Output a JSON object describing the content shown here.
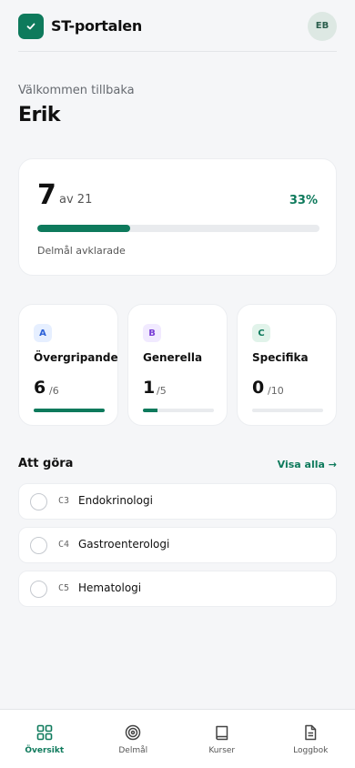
{
  "header": {
    "app_name": "ST-portalen",
    "avatar_initials": "EB"
  },
  "greeting": {
    "welcome": "Välkommen tillbaka",
    "name": "Erik"
  },
  "progress": {
    "done": "7",
    "of_label": "av 21",
    "percent_label": "33%",
    "fraction": 0.33,
    "caption": "Delmål avklarade"
  },
  "categories": [
    {
      "letter": "A",
      "title": "Övergripande",
      "done": "6",
      "total": "/6",
      "fraction": 1.0,
      "badge_bg": "#e6efff",
      "badge_color": "#2d62d8"
    },
    {
      "letter": "B",
      "title": "Generella",
      "done": "1",
      "total": "/5",
      "fraction": 0.2,
      "badge_bg": "#f1eaff",
      "badge_color": "#7a3fd6"
    },
    {
      "letter": "C",
      "title": "Specifika",
      "done": "0",
      "total": "/10",
      "fraction": 0.0,
      "badge_bg": "#e1f3ea",
      "badge_color": "#0e7a5c"
    }
  ],
  "todo": {
    "title": "Att göra",
    "see_all": "Visa alla →",
    "items": [
      {
        "code": "C3",
        "name": "Endokrinologi"
      },
      {
        "code": "C4",
        "name": "Gastroenterologi"
      },
      {
        "code": "C5",
        "name": "Hematologi"
      }
    ]
  },
  "nav": [
    {
      "label": "Översikt",
      "icon": "grid-icon",
      "active": true
    },
    {
      "label": "Delmål",
      "icon": "target-icon",
      "active": false
    },
    {
      "label": "Kurser",
      "icon": "book-icon",
      "active": false
    },
    {
      "label": "Loggbok",
      "icon": "document-icon",
      "active": false
    }
  ],
  "colors": {
    "accent": "#0e7a5c",
    "background": "#f5f6f8"
  }
}
